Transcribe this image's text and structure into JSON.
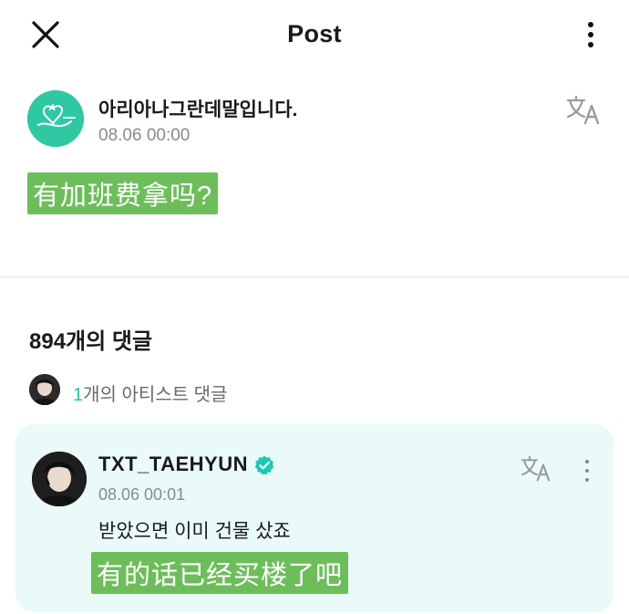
{
  "header": {
    "title": "Post",
    "close_icon": "close-icon",
    "more_icon": "more-vertical-icon"
  },
  "post": {
    "author_name": "아리아나그란데말입니다.",
    "time": "08.06 00:00",
    "body_translation": "有加班费拿吗?",
    "translate_icon": "translate-icon"
  },
  "comments": {
    "count_label": "894개의 댓글",
    "artist_count_number": "1",
    "artist_count_text": "개의 아티스트 댓글"
  },
  "artist_comment": {
    "name": "TXT_TAEHYUN",
    "time": "08.06 00:01",
    "text": "받았으면 이미 건물 샀죠",
    "translation": "有的话已经买楼了吧",
    "verified_icon": "verified-badge-icon"
  },
  "colors": {
    "highlight": "#6dbe5a",
    "card_bg": "#e9faf8",
    "accent": "#1ec8b0",
    "post_avatar": "#2ec9a3"
  }
}
